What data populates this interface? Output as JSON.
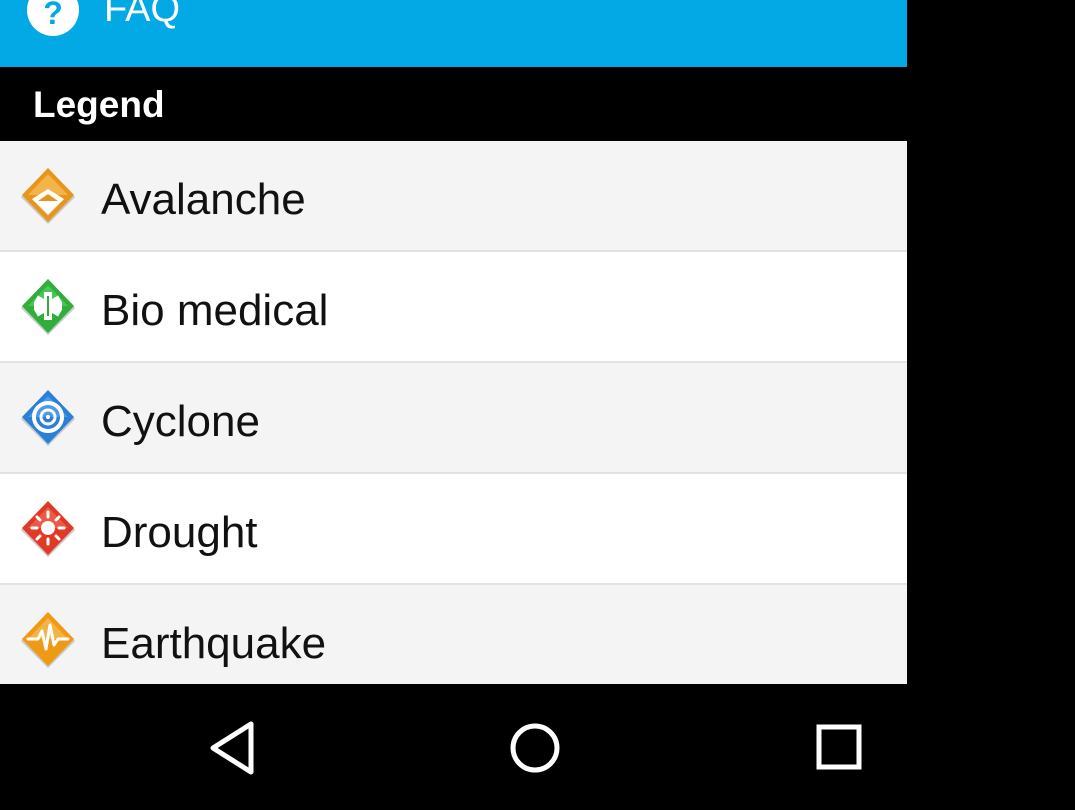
{
  "drawer": {
    "faq": {
      "label": "FAQ",
      "icon": "help-circle-icon"
    },
    "section_title": "Legend",
    "items": [
      {
        "label": "Avalanche",
        "icon": "avalanche-icon",
        "color": "#e8951c"
      },
      {
        "label": "Bio medical",
        "icon": "bio-medical-icon",
        "color": "#2fae3c"
      },
      {
        "label": "Cyclone",
        "icon": "cyclone-icon",
        "color": "#2a7fd6"
      },
      {
        "label": "Drought",
        "icon": "drought-icon",
        "color": "#e03a26"
      },
      {
        "label": "Earthquake",
        "icon": "earthquake-icon",
        "color": "#ee9a15"
      }
    ]
  },
  "colors": {
    "faq_bar": "#03a9e4",
    "section_header": "#000000"
  },
  "navigation_bar": {
    "buttons": [
      {
        "name": "back",
        "icon": "back-triangle-icon"
      },
      {
        "name": "home",
        "icon": "home-circle-icon"
      },
      {
        "name": "recents",
        "icon": "recents-square-icon"
      }
    ]
  }
}
